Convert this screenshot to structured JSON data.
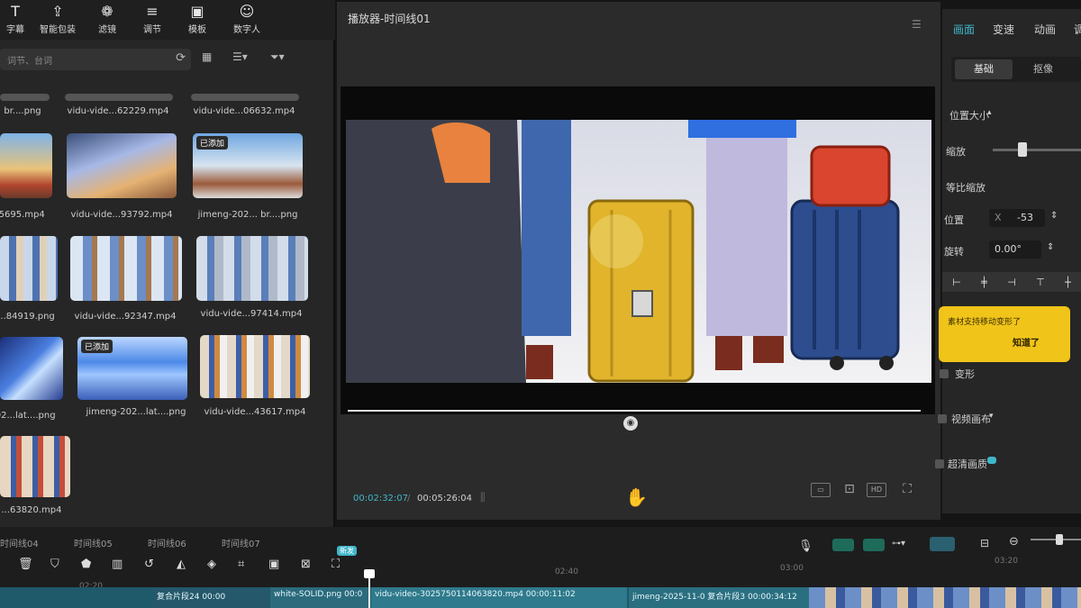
{
  "toolbar": {
    "items": [
      {
        "label": "字幕",
        "icon": "text-icon"
      },
      {
        "label": "智能包装",
        "icon": "upload-box-icon"
      },
      {
        "label": "滤镜",
        "icon": "filter-icon"
      },
      {
        "label": "调节",
        "icon": "sliders-icon"
      },
      {
        "label": "模板",
        "icon": "template-icon"
      },
      {
        "label": "数字人",
        "icon": "digital-human-icon"
      }
    ]
  },
  "media": {
    "search_placeholder": "词节、台词",
    "items": [
      {
        "label": "br....png",
        "added": false
      },
      {
        "label": "vidu-vide...62229.mp4",
        "added": false
      },
      {
        "label": "vidu-vide...06632.mp4",
        "added": false
      },
      {
        "label": "65695.mp4",
        "added": false
      },
      {
        "label": "vidu-vide...93792.mp4",
        "added": false
      },
      {
        "label": "jimeng-202... br....png",
        "added": true
      },
      {
        "label": "...84919.png",
        "added": false
      },
      {
        "label": "vidu-vide...92347.mp4",
        "added": false
      },
      {
        "label": "vidu-vide...97414.mp4",
        "added": false
      },
      {
        "label": "202...lat....png",
        "added": false
      },
      {
        "label": "jimeng-202...lat....png",
        "added": true
      },
      {
        "label": "vidu-vide...43617.mp4",
        "added": false
      },
      {
        "label": "...63820.mp4",
        "added": false
      }
    ],
    "added_badge": "已添加"
  },
  "player": {
    "title": "播放器-时间线01",
    "timecode_current": "00:02:32:07",
    "separator": "/",
    "timecode_total": "00:05:26:04",
    "progress": 0.466
  },
  "inspector": {
    "tabs": [
      "画面",
      "变速",
      "动画",
      "调"
    ],
    "subtabs": [
      "基础",
      "抠像"
    ],
    "section_title": "位置大小",
    "scale_label": "缩放",
    "uniform_label": "等比缩放",
    "position_label": "位置",
    "position_axis": "X",
    "position_x": "-53",
    "rotate_label": "旋转",
    "rotate_value": "0.00°",
    "tip_text": "素材支持移动变形了",
    "tip_ok": "知道了",
    "deform_label": "变形",
    "fill_label": "视频画布",
    "hd_label": "超清画质",
    "accent": "#3fb6c9",
    "tip_color": "#f0c419"
  },
  "timeline": {
    "tabs": [
      "时间线04",
      "时间线05",
      "时间线06",
      "时间线07"
    ],
    "new_badge": "新发",
    "ruler": [
      "02:20",
      "02:40",
      "03:00",
      "03:20"
    ],
    "clips": [
      {
        "label": "复合片段24  00:00"
      },
      {
        "label": "white-SOLID.png  00:0"
      },
      {
        "label": "vidu-video-3025750114063820.mp4  00:00:11:02"
      },
      {
        "label": "jimeng-2025-11-0   复合片段3  00:00:34:12"
      }
    ]
  }
}
